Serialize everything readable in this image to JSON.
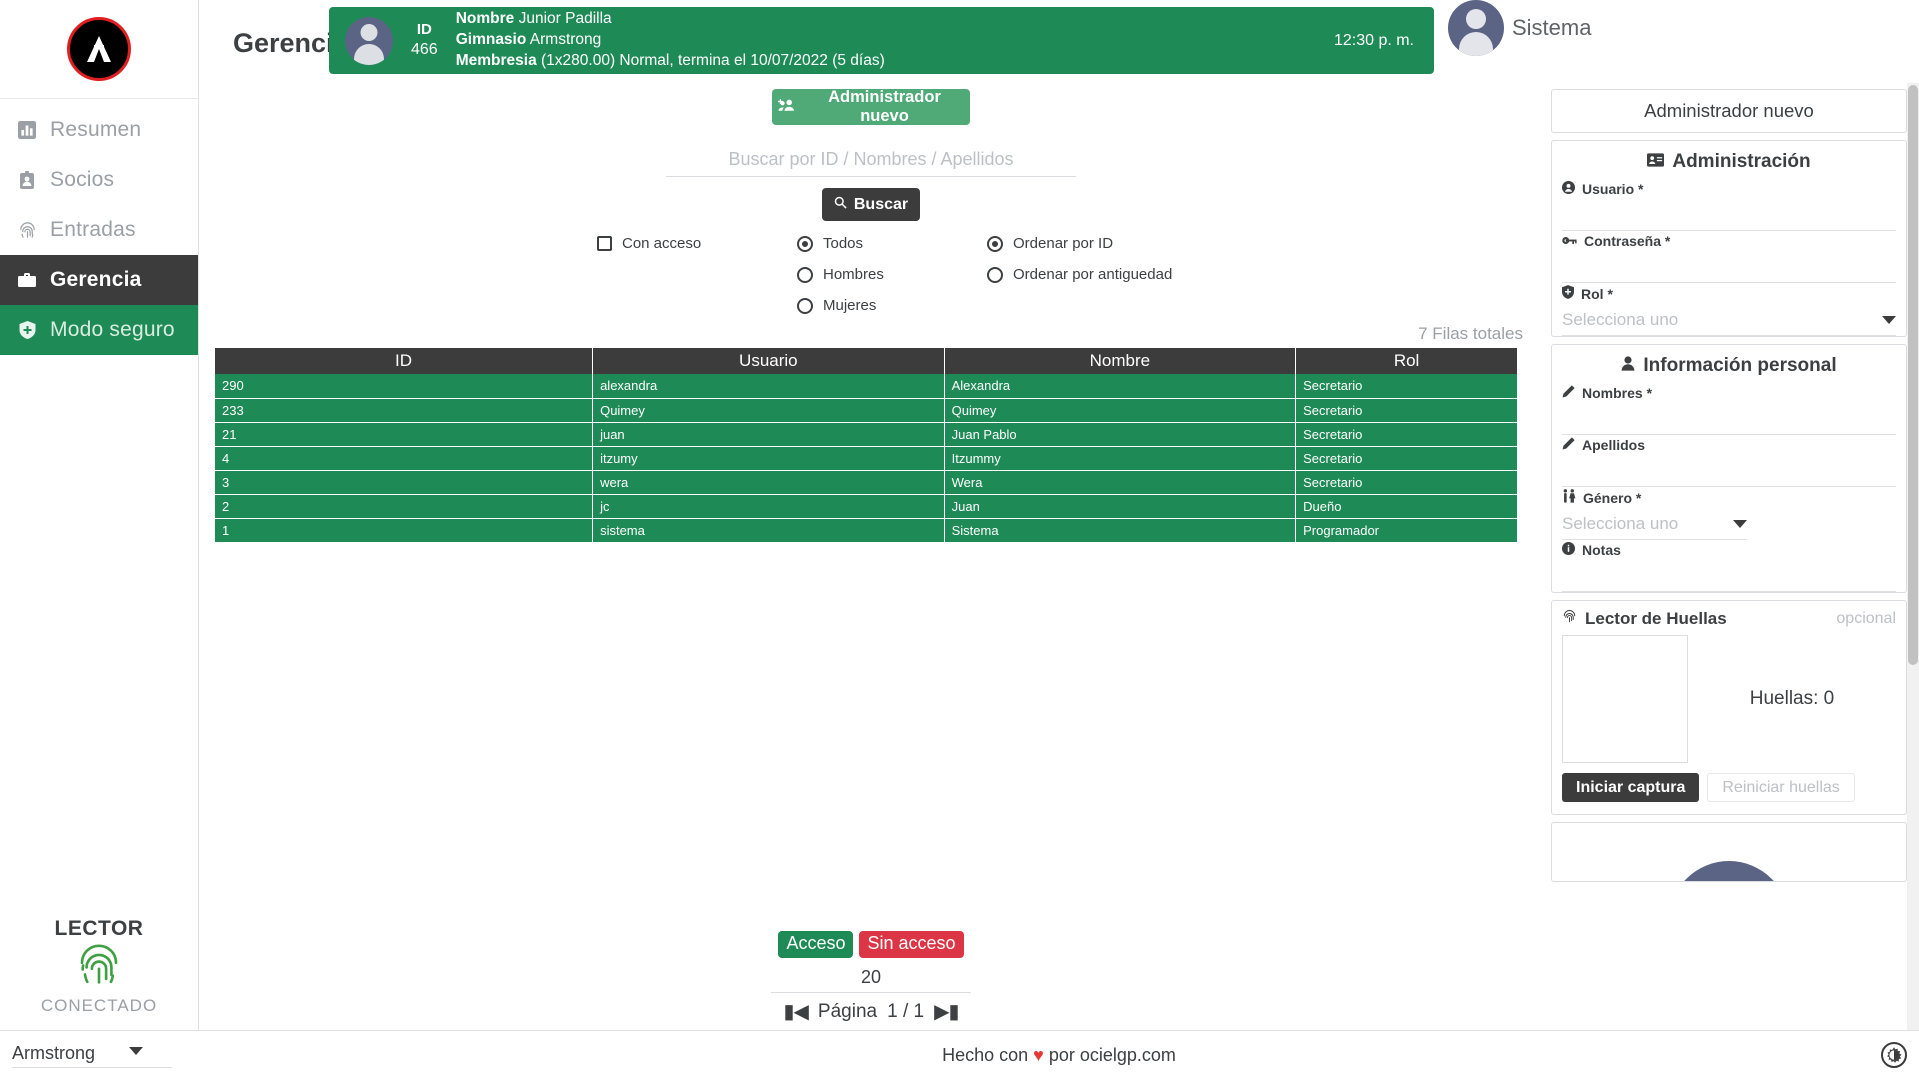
{
  "app": {
    "page_title": "Gerencia",
    "logo_icon": "armstrong-logo-icon"
  },
  "sidebar": {
    "items": [
      {
        "label": "Resumen",
        "icon": "chart-bar-icon",
        "state": "normal"
      },
      {
        "label": "Socios",
        "icon": "id-badge-icon",
        "state": "normal"
      },
      {
        "label": "Entradas",
        "icon": "fingerprint-icon",
        "state": "normal"
      },
      {
        "label": "Gerencia",
        "icon": "briefcase-icon",
        "state": "active"
      },
      {
        "label": "Modo seguro",
        "icon": "shield-icon",
        "state": "secure"
      }
    ],
    "reader": {
      "title": "LECTOR",
      "status": "CONECTADO",
      "icon": "fingerprint-icon"
    }
  },
  "banner": {
    "id_label": "ID",
    "id_value": "466",
    "name_label": "Nombre",
    "name_value": "Junior Padilla",
    "gym_label": "Gimnasio",
    "gym_value": "Armstrong",
    "membership_label": "Membresia",
    "membership_value": "(1x280.00) Normal, termina el 10/07/2022 (5 días)",
    "time": "12:30 p. m.",
    "color": "#1e8b56"
  },
  "user": {
    "name": "Sistema",
    "avatar_icon": "user-avatar-icon"
  },
  "toolbar": {
    "new_admin_label": "Administrador nuevo",
    "new_admin_icon": "add-users-icon",
    "search_placeholder": "Buscar por ID / Nombres / Apellidos",
    "search_value": "",
    "search_button_label": "Buscar",
    "search_button_icon": "search-icon"
  },
  "filters": {
    "access": {
      "label": "Con acceso",
      "checked": false
    },
    "gender": [
      {
        "label": "Todos",
        "selected": true
      },
      {
        "label": "Hombres",
        "selected": false
      },
      {
        "label": "Mujeres",
        "selected": false
      }
    ],
    "order": [
      {
        "label": "Ordenar por ID",
        "selected": true
      },
      {
        "label": "Ordenar por antiguedad",
        "selected": false
      }
    ]
  },
  "table": {
    "rows_total": "7 Filas totales",
    "columns": [
      "ID",
      "Usuario",
      "Nombre",
      "Rol"
    ],
    "rows": [
      [
        "290",
        "alexandra",
        "Alexandra",
        "Secretario"
      ],
      [
        "233",
        "Quimey",
        "Quimey",
        "Secretario"
      ],
      [
        "21",
        "juan",
        "Juan Pablo",
        "Secretario"
      ],
      [
        "4",
        "itzumy",
        "Itzummy",
        "Secretario"
      ],
      [
        "3",
        "wera",
        "Wera",
        "Secretario"
      ],
      [
        "2",
        "jc",
        "Juan",
        "Dueño"
      ],
      [
        "1",
        "sistema",
        "Sistema",
        "Programador"
      ]
    ]
  },
  "legend": {
    "access_label": "Acceso",
    "no_access_label": "Sin acceso",
    "access_color": "#1e8b56",
    "no_access_color": "#dc3545"
  },
  "pagination": {
    "per_page": "20",
    "first_icon": "first-page-icon",
    "last_icon": "last-page-icon",
    "page_label": "Página",
    "page_value": "1 / 1"
  },
  "panel": {
    "header": "Administrador nuevo",
    "admin_section": {
      "title": "Administración",
      "icon": "id-card-icon",
      "fields": [
        {
          "label": "Usuario *",
          "icon": "user-circle-icon",
          "value": "",
          "type": "text"
        },
        {
          "label": "Contraseña *",
          "icon": "key-icon",
          "value": "",
          "type": "text"
        },
        {
          "label": "Rol *",
          "icon": "shield-icon",
          "value": "",
          "type": "select",
          "placeholder": "Selecciona uno"
        }
      ]
    },
    "personal_section": {
      "title": "Información personal",
      "icon": "person-icon",
      "fields": [
        {
          "label": "Nombres *",
          "icon": "pencil-icon",
          "value": "",
          "type": "text"
        },
        {
          "label": "Apellidos",
          "icon": "pencil-icon",
          "value": "",
          "type": "text"
        },
        {
          "label": "Género *",
          "icon": "gender-icon",
          "value": "",
          "type": "select",
          "placeholder": "Selecciona uno"
        },
        {
          "label": "Notas",
          "icon": "info-icon",
          "value": "",
          "type": "text"
        }
      ]
    },
    "fingerprint_section": {
      "title": "Lector de Huellas",
      "icon": "fingerprint-icon",
      "optional_label": "opcional",
      "count_label": "Huellas: 0",
      "start_button": "Iniciar captura",
      "reset_button": "Reiniciar huellas"
    }
  },
  "footer": {
    "gym": "Armstrong",
    "credit_prefix": "Hecho con ",
    "credit_heart": "♥",
    "credit_suffix": " por ocielgp.com",
    "theme_icon": "brightness-icon"
  }
}
